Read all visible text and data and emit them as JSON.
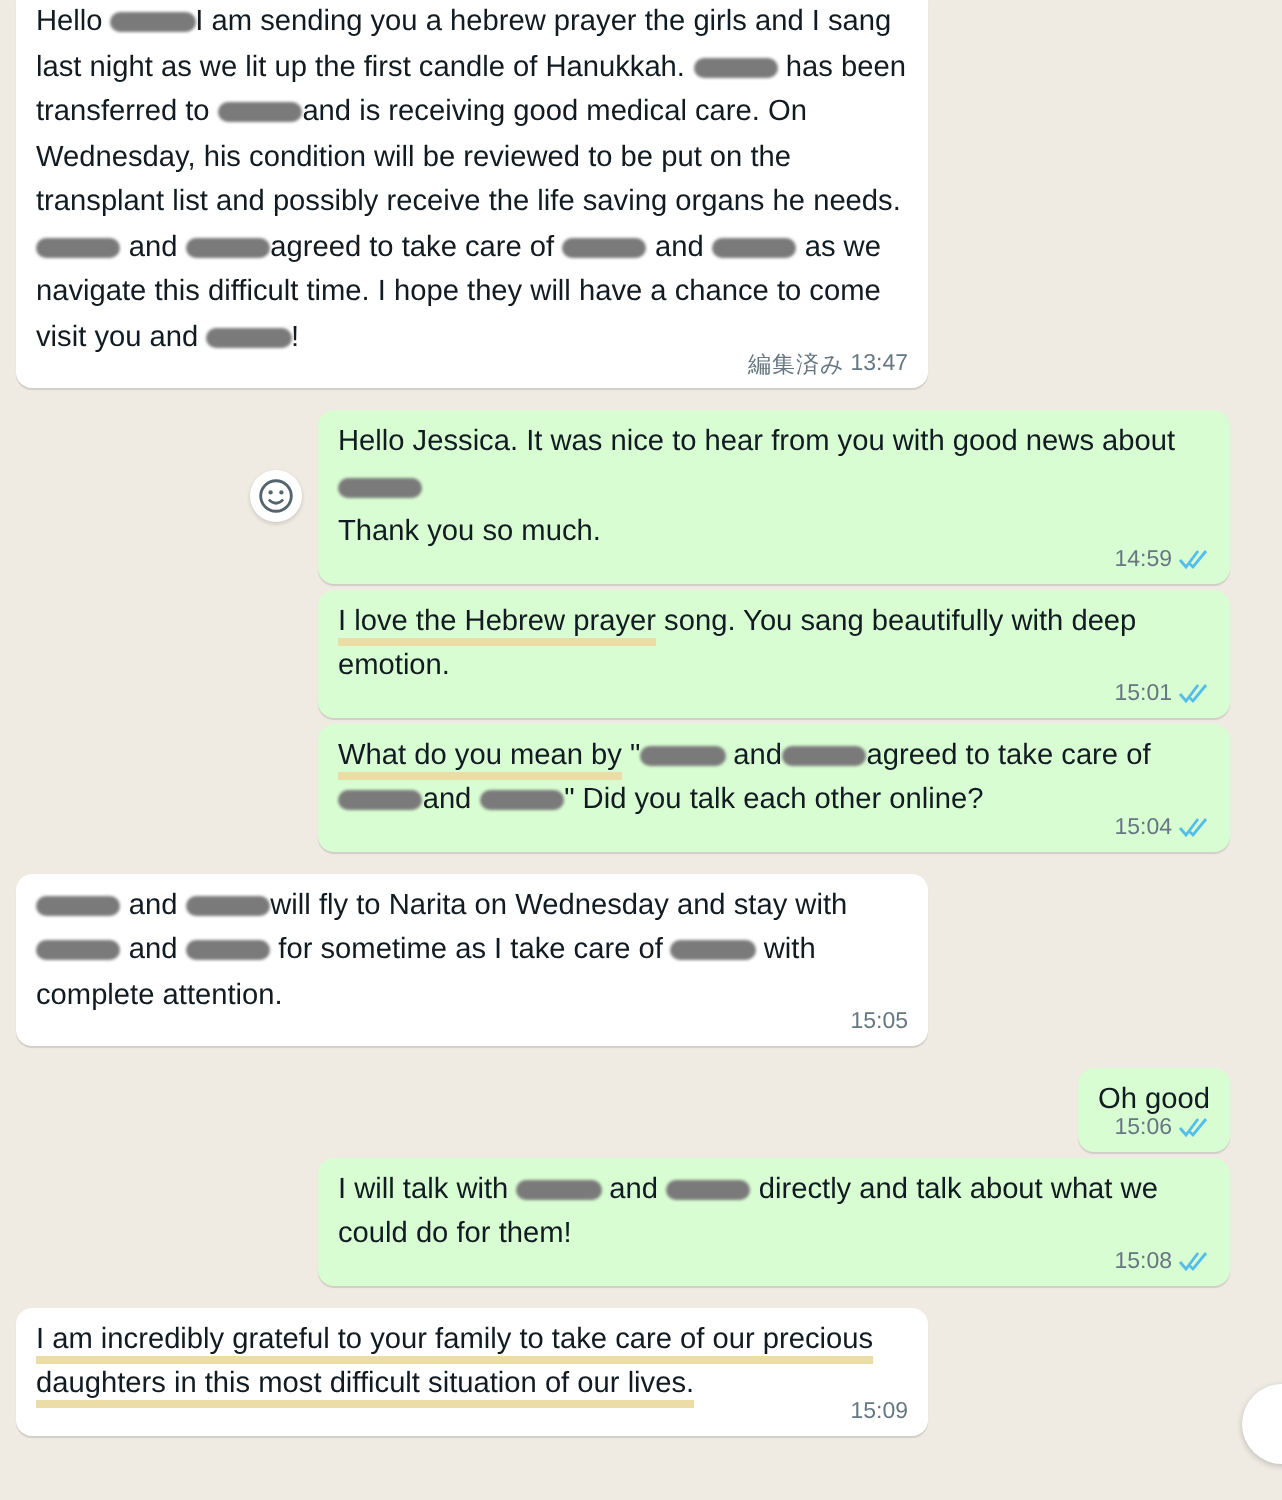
{
  "messages": [
    {
      "kind": "received",
      "paragraphs": [
        [
          {
            "text": "Hello "
          },
          {
            "kind": "redacted"
          },
          {
            "text": "I am sending you a hebrew prayer the girls and I sang last night as we lit up the first candle of Hanukkah. "
          },
          {
            "kind": "redacted"
          },
          {
            "text": " has been transferred to "
          },
          {
            "kind": "redacted"
          },
          {
            "text": "and is receiving good medical care. On Wednesday, his condition will be reviewed to be put on the transplant list and possibly receive the life saving organs he needs."
          }
        ],
        [
          {
            "kind": "redacted"
          },
          {
            "text": " and "
          },
          {
            "kind": "redacted"
          },
          {
            "text": "agreed to take care of "
          },
          {
            "kind": "redacted"
          },
          {
            "text": " and "
          },
          {
            "kind": "redacted"
          },
          {
            "text": " as we navigate this difficult time. I hope they will have a chance to come visit you and "
          },
          {
            "kind": "redacted"
          },
          {
            "text": "!"
          }
        ]
      ],
      "edited": "編集済み",
      "time": "13:47"
    },
    {
      "kind": "sent",
      "reaction_button": true,
      "paragraphs": [
        [
          {
            "text": "Hello Jessica. It was nice to hear from you with good news about "
          },
          {
            "kind": "redacted"
          }
        ],
        [
          {
            "text": "Thank you so much."
          }
        ]
      ],
      "time": "14:59",
      "read": true
    },
    {
      "kind": "sent",
      "paragraphs": [
        [
          {
            "text": "I love the Hebrew prayer",
            "highlighted": true
          },
          {
            "text": " song. You sang beautifully with deep emotion."
          }
        ]
      ],
      "time": "15:01",
      "read": true
    },
    {
      "kind": "sent",
      "paragraphs": [
        [
          {
            "text": "What do you mean by",
            "highlighted": true
          },
          {
            "text": " \""
          },
          {
            "kind": "redacted"
          },
          {
            "text": " and"
          },
          {
            "kind": "redacted"
          },
          {
            "text": "agreed to take care of "
          },
          {
            "kind": "redacted"
          },
          {
            "text": "and "
          },
          {
            "kind": "redacted"
          },
          {
            "text": "\" Did you talk each other online?"
          }
        ]
      ],
      "time": "15:04",
      "read": true
    },
    {
      "kind": "received",
      "paragraphs": [
        [
          {
            "kind": "redacted"
          },
          {
            "text": " and "
          },
          {
            "kind": "redacted"
          },
          {
            "text": "will fly to Narita on Wednesday and stay with "
          },
          {
            "kind": "redacted"
          },
          {
            "text": " and "
          },
          {
            "kind": "redacted"
          },
          {
            "text": " for sometime as I take care of "
          },
          {
            "kind": "redacted"
          },
          {
            "text": " with complete attention."
          }
        ]
      ],
      "time": "15:05"
    },
    {
      "kind": "sent",
      "paragraphs": [
        [
          {
            "text": "Oh good"
          }
        ]
      ],
      "time": "15:06",
      "read": true
    },
    {
      "kind": "sent",
      "paragraphs": [
        [
          {
            "text": "I will talk with "
          },
          {
            "kind": "redacted"
          },
          {
            "text": " and "
          },
          {
            "kind": "redacted"
          },
          {
            "text": " directly and talk about what we could do for them!"
          }
        ]
      ],
      "time": "15:08",
      "read": true
    },
    {
      "kind": "received",
      "paragraphs": [
        [
          {
            "text": "I am incredibly grateful to your family to take care of our precious daughters in this most difficult situation of our lives.",
            "highlighted": true
          }
        ]
      ],
      "time": "15:09"
    }
  ]
}
